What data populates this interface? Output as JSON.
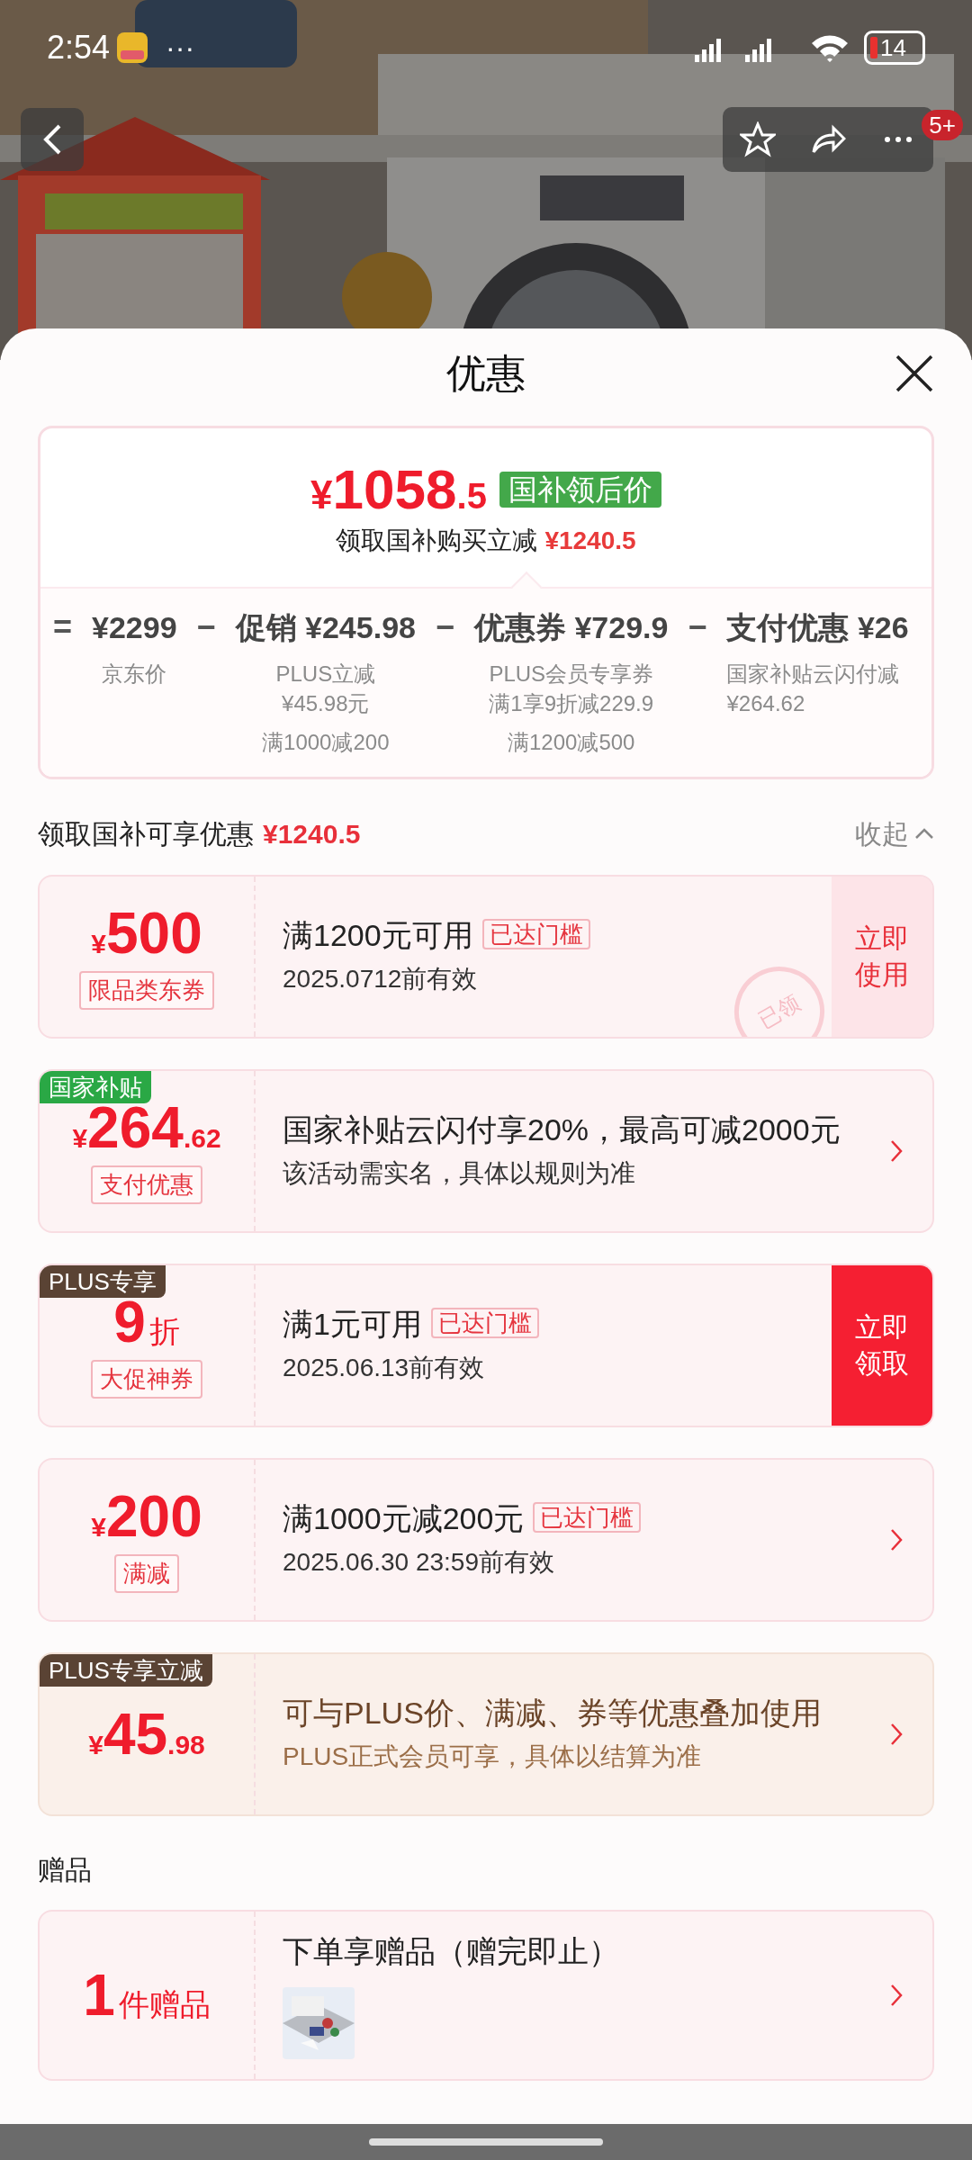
{
  "status_bar": {
    "time": "2:54",
    "more": "···",
    "battery": "14"
  },
  "header": {
    "badge": "5+"
  },
  "sheet": {
    "title": "优惠"
  },
  "summary": {
    "currency": "¥",
    "price_int": "1058",
    "price_dec": ".5",
    "price_tag": "国补领后价",
    "saving_label": "领取国补购买立减",
    "saving_value": "¥1240.5",
    "breakdown": [
      {
        "op": "=",
        "value": "¥2299",
        "notes": [
          [
            "京东价"
          ]
        ]
      },
      {
        "op": "−",
        "label": "促销",
        "value": "¥245.98",
        "notes": [
          [
            "PLUS立减",
            "¥45.98元"
          ],
          [
            "满1000减200"
          ]
        ]
      },
      {
        "op": "−",
        "label": "优惠券",
        "value": "¥729.9",
        "notes": [
          [
            "PLUS会员专享券",
            "满1享9折减229.9"
          ],
          [
            "满1200减500"
          ]
        ]
      },
      {
        "op": "−",
        "label": "支付优惠",
        "value": "¥26",
        "notes": [
          [
            "国家补贴云闪付减",
            "¥264.62"
          ]
        ]
      }
    ]
  },
  "offers_header": {
    "label": "领取国补可享优惠",
    "value": "¥1240.5",
    "toggle": "收起"
  },
  "offers": [
    {
      "kind": "coupon",
      "currency": "¥",
      "amount": "500",
      "type_tag": "限品类东券",
      "title": "满1200元可用",
      "threshold": "已达门槛",
      "subtitle": "2025.0712前有效",
      "action": {
        "label": "立即使用",
        "claimed": true
      },
      "stamp": "已领"
    },
    {
      "kind": "coupon",
      "corner_tag": {
        "text": "国家补贴",
        "color": "#2aa845"
      },
      "currency": "¥",
      "amount": "264",
      "amount_dec": ".62",
      "type_tag": "支付优惠",
      "title": "国家补贴云闪付享20%，最高可减2000元",
      "subtitle": "该活动需实名，具体以规则为准"
    },
    {
      "kind": "coupon",
      "corner_tag": {
        "text": "PLUS专享",
        "color": "#5a4334"
      },
      "amount": "9",
      "unit": "折",
      "type_tag": "大促神券",
      "title": "满1元可用",
      "threshold": "已达门槛",
      "subtitle": "2025.06.13前有效",
      "action": {
        "label": "立即领取",
        "claimed": false
      }
    },
    {
      "kind": "coupon",
      "currency": "¥",
      "amount": "200",
      "type_tag": "满减",
      "title": "满1000元减200元",
      "threshold": "已达门槛",
      "subtitle": "2025.06.30 23:59前有效"
    },
    {
      "kind": "plus",
      "corner_tag": {
        "text": "PLUS专享立减",
        "color": "#5a4334"
      },
      "currency": "¥",
      "amount": "45",
      "amount_dec": ".98",
      "title": "可与PLUS价、满减、券等优惠叠加使用",
      "subtitle": "PLUS正式会员可享，具体以结算为准"
    }
  ],
  "gifts_header": "赠品",
  "gifts": [
    {
      "kind": "gift",
      "amount": "1",
      "unit": "件赠品",
      "title": "下单享赠品（赠完即止）"
    }
  ]
}
